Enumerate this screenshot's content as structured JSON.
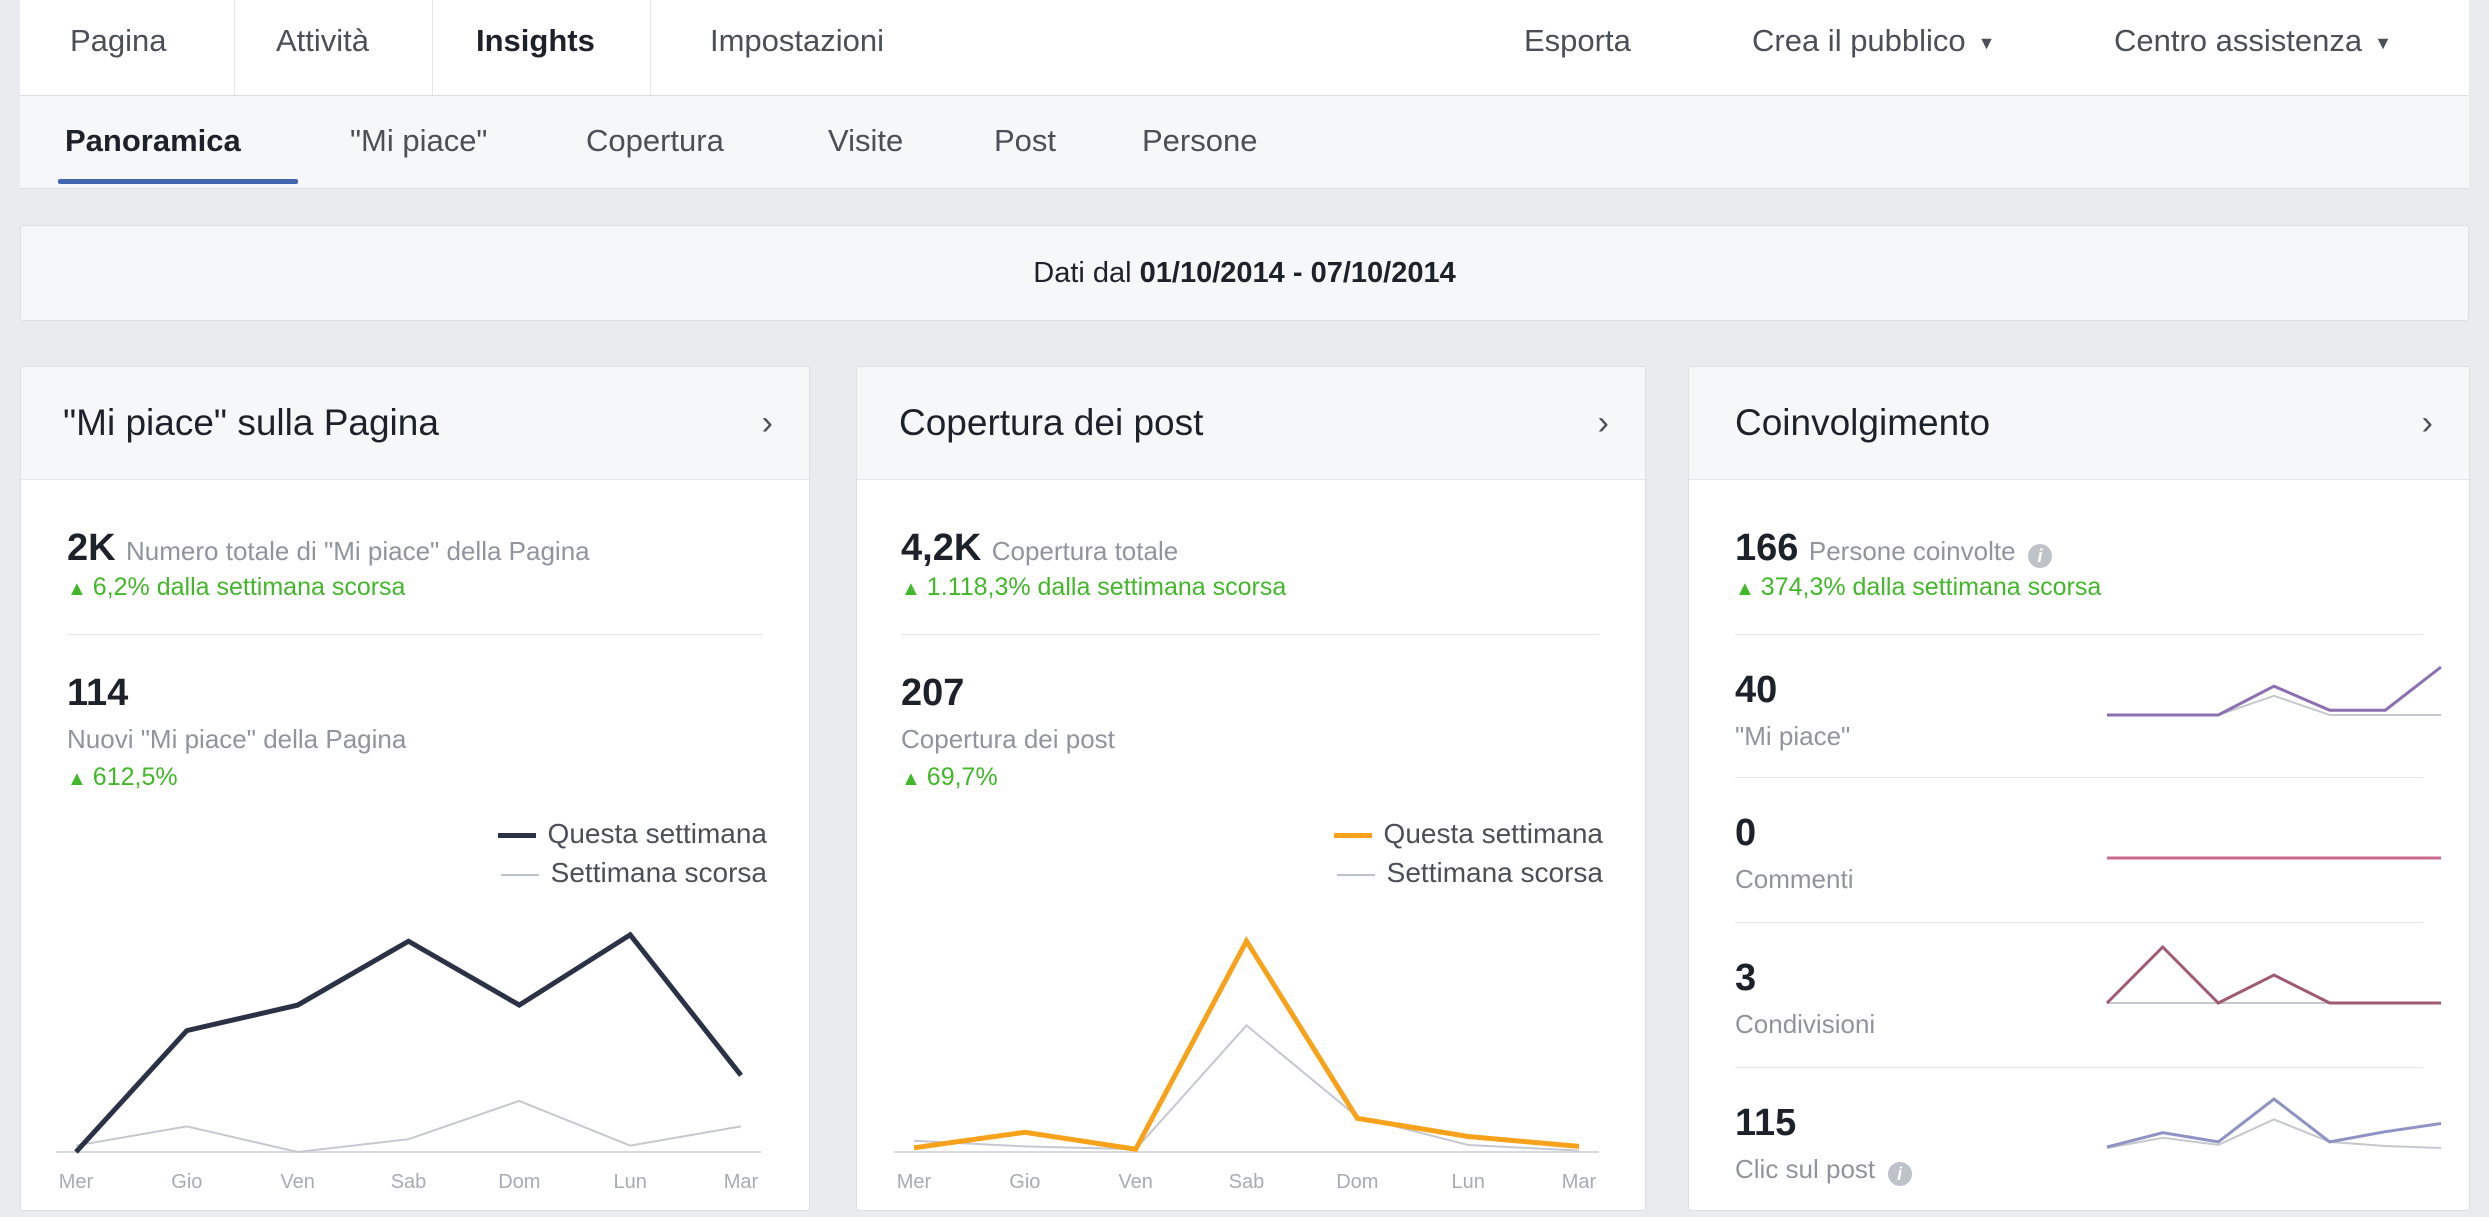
{
  "topnav": {
    "items": [
      "Pagina",
      "Attività",
      "Insights",
      "Impostazioni"
    ],
    "right": {
      "export": "Esporta",
      "audience": "Crea il pubblico",
      "help": "Centro assistenza"
    }
  },
  "subnav": {
    "items": [
      "Panoramica",
      "\"Mi piace\"",
      "Copertura",
      "Visite",
      "Post",
      "Persone"
    ]
  },
  "datebar": {
    "prefix": "Dati dal",
    "range": "01/10/2014 - 07/10/2014"
  },
  "cards": {
    "likes": {
      "title": "\"Mi piace\" sulla Pagina",
      "total_value": "2K",
      "total_label": "Numero totale di \"Mi piace\" della Pagina",
      "total_change": "6,2% dalla settimana scorsa",
      "new_value": "114",
      "new_label": "Nuovi \"Mi piace\" della Pagina",
      "new_change": "612,5%"
    },
    "reach": {
      "title": "Copertura dei post",
      "total_value": "4,2K",
      "total_label": "Copertura totale",
      "total_change": "1.118,3% dalla settimana scorsa",
      "post_value": "207",
      "post_label": "Copertura dei post",
      "post_change": "69,7%"
    },
    "engagement": {
      "title": "Coinvolgimento",
      "people_value": "166",
      "people_label": "Persone coinvolte",
      "people_change": "374,3% dalla settimana scorsa",
      "metrics": [
        {
          "value": "40",
          "label": "\"Mi piace\""
        },
        {
          "value": "0",
          "label": "Commenti"
        },
        {
          "value": "3",
          "label": "Condivisioni"
        },
        {
          "value": "115",
          "label": "Clic sul post"
        }
      ]
    }
  },
  "legend": {
    "this_week": "Questa settimana",
    "last_week": "Settimana scorsa"
  },
  "colors": {
    "likes_line": "#2b3245",
    "reach_line": "#f7a21a",
    "likes_spark": "#8b6fb0",
    "comments_spark": "#c96b8a",
    "shares_spark": "#a05a72",
    "clicks_spark": "#8f93c4",
    "last_week": "#c5c8ce",
    "accent": "#4267b2",
    "positive": "#42b72a"
  },
  "chart_data": [
    {
      "type": "line",
      "chart": "likes",
      "categories": [
        "Mer",
        "Gio",
        "Ven",
        "Sab",
        "Dom",
        "Lun",
        "Mar"
      ],
      "series": [
        {
          "name": "Questa settimana",
          "values": [
            0,
            19,
            23,
            33,
            23,
            34,
            12
          ]
        },
        {
          "name": "Settimana scorsa",
          "values": [
            1,
            4,
            0,
            2,
            8,
            1,
            4
          ]
        }
      ],
      "ylim": [
        0,
        36
      ]
    },
    {
      "type": "line",
      "chart": "reach",
      "categories": [
        "Mer",
        "Gio",
        "Ven",
        "Sab",
        "Dom",
        "Lun",
        "Mar"
      ],
      "series": [
        {
          "name": "Questa settimana",
          "values": [
            3,
            14,
            2,
            150,
            24,
            11,
            4
          ]
        },
        {
          "name": "Settimana scorsa",
          "values": [
            8,
            4,
            2,
            90,
            25,
            5,
            1
          ]
        }
      ],
      "ylim": [
        0,
        160
      ]
    },
    {
      "type": "line",
      "chart": "engagement-likes",
      "series": [
        {
          "name": "Questa settimana",
          "values": [
            0,
            0,
            0,
            6,
            1,
            1,
            10
          ]
        },
        {
          "name": "Settimana scorsa",
          "values": [
            0,
            0,
            0,
            4,
            0,
            0,
            0
          ]
        }
      ],
      "ylim": [
        0,
        10
      ]
    },
    {
      "type": "line",
      "chart": "engagement-comments",
      "series": [
        {
          "name": "Questa settimana",
          "values": [
            0,
            0,
            0,
            0,
            0,
            0,
            0
          ]
        },
        {
          "name": "Settimana scorsa",
          "values": [
            0,
            0,
            0,
            0,
            0,
            0,
            0
          ]
        }
      ],
      "ylim": [
        0,
        10
      ]
    },
    {
      "type": "line",
      "chart": "engagement-shares",
      "series": [
        {
          "name": "Questa settimana",
          "values": [
            0,
            2,
            0,
            1,
            0,
            0,
            0
          ]
        },
        {
          "name": "Settimana scorsa",
          "values": [
            0,
            0,
            0,
            0,
            0,
            0,
            0
          ]
        }
      ],
      "ylim": [
        0,
        2
      ]
    },
    {
      "type": "line",
      "chart": "engagement-clicks",
      "series": [
        {
          "name": "Questa settimana",
          "values": [
            1,
            15,
            6,
            48,
            6,
            16,
            24
          ]
        },
        {
          "name": "Settimana scorsa",
          "values": [
            0,
            10,
            3,
            28,
            6,
            2,
            0
          ]
        }
      ],
      "ylim": [
        0,
        50
      ]
    }
  ]
}
